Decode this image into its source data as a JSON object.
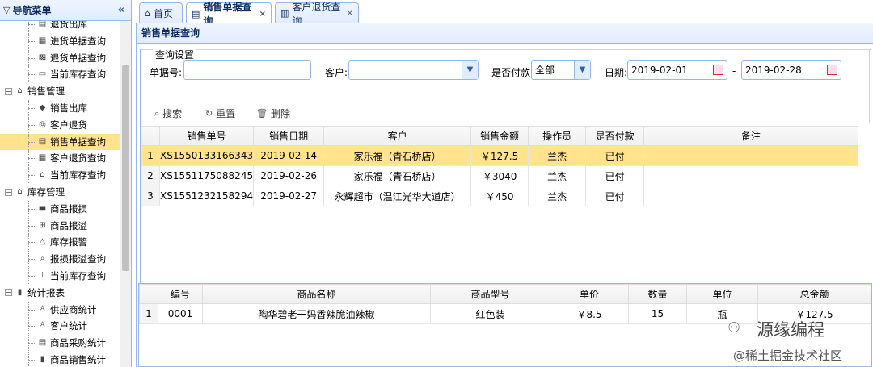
{
  "sidebar": {
    "title": "导航菜单",
    "collapse_icon": "«",
    "nodes": [
      {
        "label": "退货出库",
        "level": 2,
        "icon": "doc-icon"
      },
      {
        "label": "进货单据查询",
        "level": 2,
        "icon": "search-doc-icon"
      },
      {
        "label": "退货单据查询",
        "level": 2,
        "icon": "calc-icon"
      },
      {
        "label": "当前库存查询",
        "level": 2,
        "icon": "stock-icon"
      },
      {
        "label": "销售管理",
        "level": 1,
        "icon": "home-icon"
      },
      {
        "label": "销售出库",
        "level": 2,
        "icon": "tag-icon"
      },
      {
        "label": "客户退货",
        "level": 2,
        "icon": "return-icon"
      },
      {
        "label": "销售单据查询",
        "level": 2,
        "icon": "doc-icon",
        "selected": true
      },
      {
        "label": "客户退货查询",
        "level": 2,
        "icon": "search-doc-icon"
      },
      {
        "label": "当前库存查询",
        "level": 2,
        "icon": "home-icon"
      },
      {
        "label": "库存管理",
        "level": 1,
        "icon": "home-icon"
      },
      {
        "label": "商品报损",
        "level": 2,
        "icon": "minus-icon"
      },
      {
        "label": "商品报溢",
        "level": 2,
        "icon": "plus-icon"
      },
      {
        "label": "库存报警",
        "level": 2,
        "icon": "warning-icon"
      },
      {
        "label": "报损报溢查询",
        "level": 2,
        "icon": "search-icon"
      },
      {
        "label": "当前库存查询",
        "level": 2,
        "icon": "tree-icon"
      },
      {
        "label": "统计报表",
        "level": 1,
        "icon": "chart-icon"
      },
      {
        "label": "供应商统计",
        "level": 2,
        "icon": "user-icon"
      },
      {
        "label": "客户统计",
        "level": 2,
        "icon": "user-icon"
      },
      {
        "label": "商品采购统计",
        "level": 2,
        "icon": "doc-icon"
      },
      {
        "label": "商品销售统计",
        "level": 2,
        "icon": "chart-icon"
      }
    ]
  },
  "tabs": [
    {
      "label": "首页",
      "icon": "home-icon",
      "closable": false
    },
    {
      "label": "销售单据查询",
      "icon": "doc-icon",
      "closable": true,
      "active": true
    },
    {
      "label": "客户退货查询",
      "icon": "search-doc-icon",
      "closable": true
    }
  ],
  "close_glyph": "×",
  "panel_title": "销售单据查询",
  "query": {
    "legend": "查询设置",
    "bill_no_label": "单据号:",
    "bill_no_value": "",
    "customer_label": "客户:",
    "customer_value": "",
    "paid_label": "是否付款:",
    "paid_value": "全部",
    "date_label": "日期:",
    "date_from": "2019-02-01",
    "date_sep": "-",
    "date_to": "2019-02-28",
    "search_label": "搜索",
    "reset_label": "重置",
    "delete_label": "删除"
  },
  "sales_grid": {
    "columns": [
      "销售单号",
      "销售日期",
      "客户",
      "销售金额",
      "操作员",
      "是否付款",
      "备注"
    ],
    "rows": [
      {
        "n": "1",
        "no": "XS1550133166343",
        "date": "2019-02-14",
        "customer": "家乐福（青石桥店）",
        "amount": "￥127.5",
        "op": "兰杰",
        "paid": "已付",
        "note": ""
      },
      {
        "n": "2",
        "no": "XS1551175088245",
        "date": "2019-02-26",
        "customer": "家乐福（青石桥店）",
        "amount": "￥3040",
        "op": "兰杰",
        "paid": "已付",
        "note": ""
      },
      {
        "n": "3",
        "no": "XS1551232158294",
        "date": "2019-02-27",
        "customer": "永辉超市（温江光华大道店）",
        "amount": "￥450",
        "op": "兰杰",
        "paid": "已付",
        "note": ""
      }
    ]
  },
  "detail_grid": {
    "columns": [
      "编号",
      "商品名称",
      "商品型号",
      "单价",
      "数量",
      "单位",
      "总金额"
    ],
    "rows": [
      {
        "n": "1",
        "code": "0001",
        "name": "陶华碧老干妈香辣脆油辣椒",
        "model": "红色装",
        "price": "￥8.5",
        "qty": "15",
        "unit": "瓶",
        "total": "￥127.5"
      }
    ]
  },
  "watermark": {
    "brand": "源缘编程",
    "site": "@稀土掘金技术社区"
  }
}
